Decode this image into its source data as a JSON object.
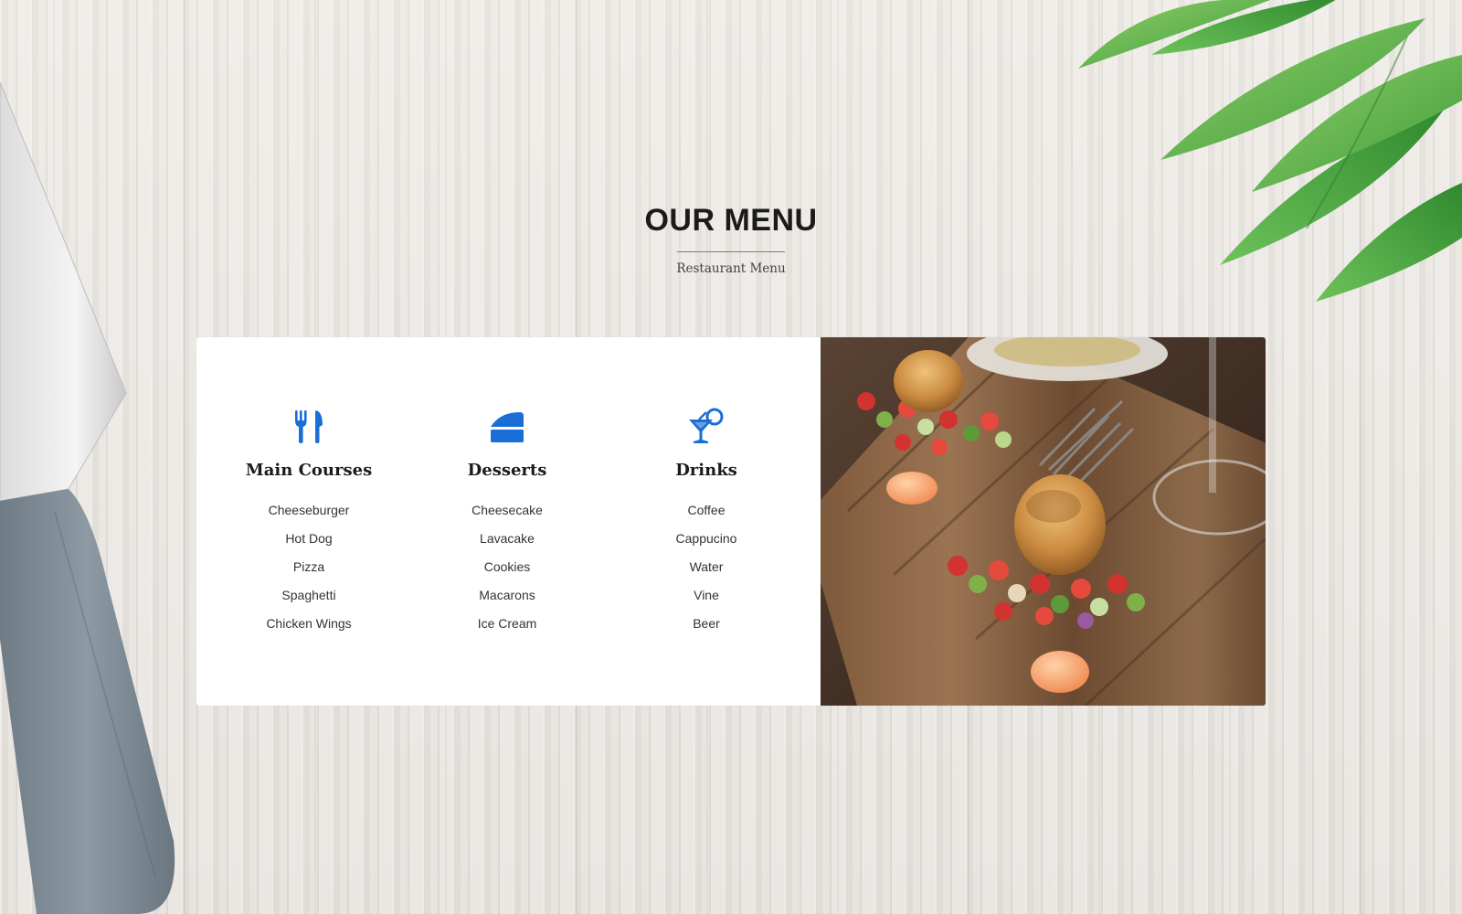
{
  "header": {
    "title": "OUR MENU",
    "subtitle": "Restaurant Menu"
  },
  "menu": {
    "accent_color": "#1a6fd6",
    "categories": [
      {
        "title": "Main Courses",
        "icon": "utensils-icon",
        "items": [
          "Cheeseburger",
          "Hot Dog",
          "Pizza",
          "Spaghetti",
          "Chicken Wings"
        ]
      },
      {
        "title": "Desserts",
        "icon": "cake-slice-icon",
        "items": [
          "Cheesecake",
          "Lavacake",
          "Cookies",
          "Macarons",
          "Ice Cream"
        ]
      },
      {
        "title": "Drinks",
        "icon": "cocktail-icon",
        "items": [
          "Coffee",
          "Cappucino",
          "Water",
          "Vine",
          "Beer"
        ]
      }
    ]
  }
}
